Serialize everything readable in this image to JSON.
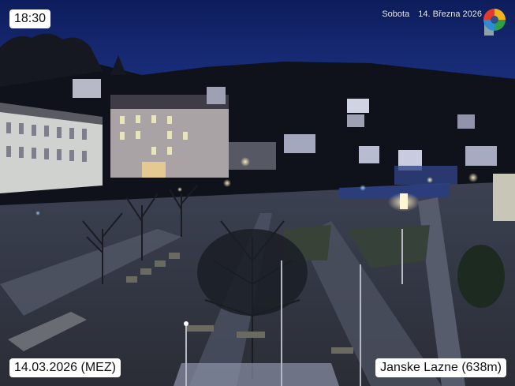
{
  "overlay": {
    "time": "18:30",
    "weekday": "Sobota",
    "date_long": "14. Března 2026",
    "date_short": "14.03.2026 (MEZ)",
    "location": "Janske Lazne (638m)"
  },
  "logo": {
    "icon": "webcam-logo-icon",
    "colors": [
      "#e23b2e",
      "#f2b21c",
      "#2e9e48",
      "#2e8bd6"
    ]
  },
  "scene": {
    "description_icon": "night-town-square-photo"
  }
}
